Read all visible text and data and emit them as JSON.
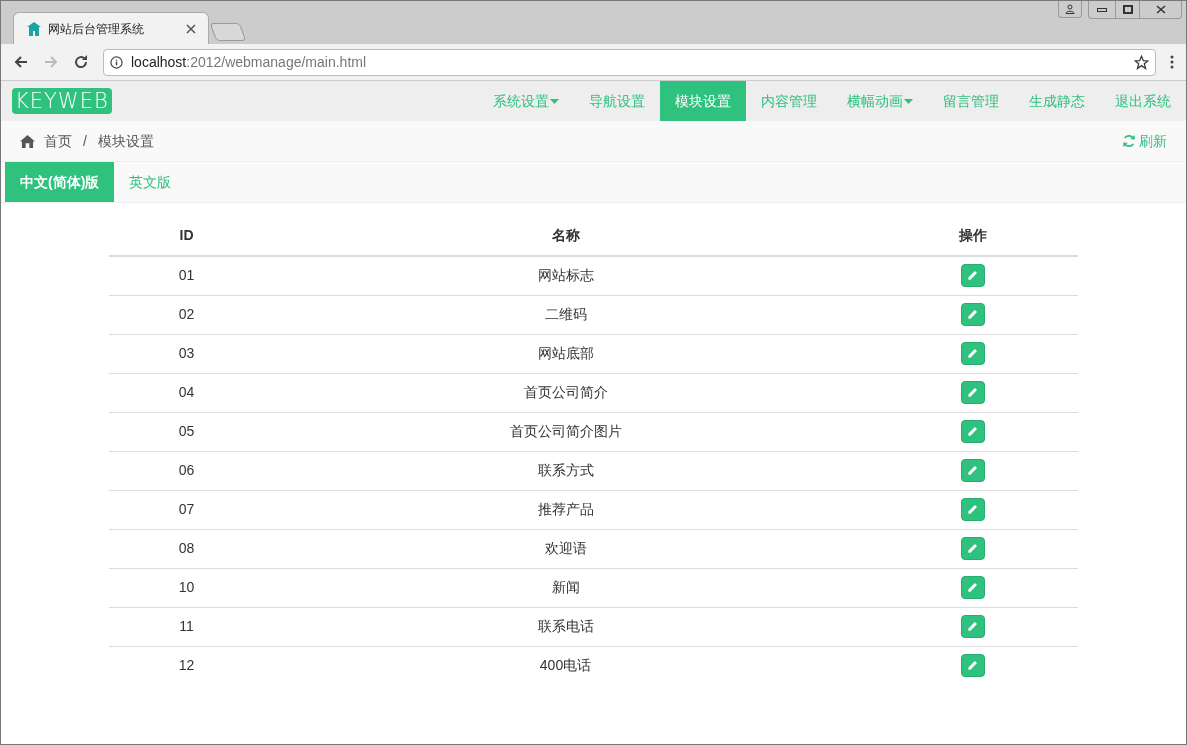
{
  "browser": {
    "tab_title": "网站后台管理系统",
    "url_host": "localhost",
    "url_path": ":2012/webmanage/main.html"
  },
  "navbar": {
    "logo": "KEYWEB",
    "items": [
      {
        "label": "系统设置",
        "has_menu": true,
        "selected": false
      },
      {
        "label": "导航设置",
        "has_menu": false,
        "selected": false
      },
      {
        "label": "模块设置",
        "has_menu": false,
        "selected": true
      },
      {
        "label": "内容管理",
        "has_menu": false,
        "selected": false
      },
      {
        "label": "横幅动画",
        "has_menu": true,
        "selected": false
      },
      {
        "label": "留言管理",
        "has_menu": false,
        "selected": false
      },
      {
        "label": "生成静态",
        "has_menu": false,
        "selected": false
      },
      {
        "label": "退出系统",
        "has_menu": false,
        "selected": false
      }
    ]
  },
  "breadcrumb": {
    "items": [
      "首页",
      "模块设置"
    ],
    "separator": "/",
    "refresh": "刷新"
  },
  "language_tabs": [
    {
      "label": "中文(简体)版",
      "selected": true
    },
    {
      "label": "英文版",
      "selected": false
    }
  ],
  "table": {
    "columns": [
      "ID",
      "名称",
      "操作"
    ],
    "rows": [
      {
        "id": "01",
        "name": "网站标志"
      },
      {
        "id": "02",
        "name": "二维码"
      },
      {
        "id": "03",
        "name": "网站底部"
      },
      {
        "id": "04",
        "name": "首页公司简介"
      },
      {
        "id": "05",
        "name": "首页公司简介图片"
      },
      {
        "id": "06",
        "name": "联系方式"
      },
      {
        "id": "07",
        "name": "推荐产品"
      },
      {
        "id": "08",
        "name": "欢迎语"
      },
      {
        "id": "10",
        "name": "新闻"
      },
      {
        "id": "11",
        "name": "联系电话"
      },
      {
        "id": "12",
        "name": "400电话"
      }
    ]
  }
}
